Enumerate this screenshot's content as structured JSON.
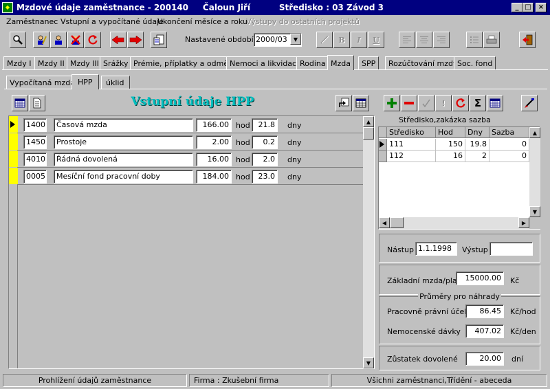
{
  "window": {
    "title": "Mzdové údaje zaměstnance - 200140     Čaloun Jiří          Středisko : 03 Závod 3",
    "icon": "app-icon"
  },
  "menu": {
    "employee": "Zaměstnanec",
    "inputs": "Vstupní a vypočítané údaje",
    "closing": "Ukončení měsíce a roku",
    "outputs": "Výstupy do ostatních projektů"
  },
  "toolbar": {
    "period_label": "Nastavené období",
    "period_value": "2000/03",
    "bold": "B",
    "italic": "I",
    "underline": "U"
  },
  "tabs": [
    {
      "label": "Mzdy I"
    },
    {
      "label": "Mzdy II"
    },
    {
      "label": "Mzdy III"
    },
    {
      "label": "Srážky"
    },
    {
      "label": "Prémie, příplatky a odměny"
    },
    {
      "label": "Nemoci a likvidace"
    },
    {
      "label": "Rodina"
    },
    {
      "label": "Mzda"
    },
    {
      "label": "SPP"
    },
    {
      "label": "Rozúčtování mzdy"
    },
    {
      "label": "Soc. fond"
    }
  ],
  "subtabs": [
    {
      "label": "Vypočítaná mzda"
    },
    {
      "label": "HPP"
    },
    {
      "label": "úklid"
    }
  ],
  "main": {
    "heading": "Vstupní údaje HPP",
    "rows": [
      {
        "code": "1400",
        "name": "Časová mzda",
        "hours": "166.00",
        "hours_unit": "hod",
        "days": "21.8",
        "days_unit": "dny"
      },
      {
        "code": "1450",
        "name": "Prostoje",
        "hours": "2.00",
        "hours_unit": "hod",
        "days": "0.2",
        "days_unit": "dny"
      },
      {
        "code": "4010",
        "name": "Řádná dovolená",
        "hours": "16.00",
        "hours_unit": "hod",
        "days": "2.0",
        "days_unit": "dny"
      },
      {
        "code": "0005",
        "name": "Mesíční fond pracovní doby",
        "hours": "184.00",
        "hours_unit": "hod",
        "days": "23.0",
        "days_unit": "dny"
      }
    ]
  },
  "cost_grid": {
    "title": "Středisko,zakázka sazba",
    "columns": [
      "Středisko",
      "Hod",
      "Dny",
      "Sazba"
    ],
    "rows": [
      [
        "111",
        "150",
        "19.8",
        "0"
      ],
      [
        "112",
        "16",
        "2",
        "0"
      ]
    ],
    "sigma": "Σ"
  },
  "employment": {
    "start_label": "Nástup",
    "start_value": "1.1.1998",
    "end_label": "Výstup",
    "end_value": "",
    "salary_label": "Základní mzda/plat",
    "salary_value": "15000.00",
    "salary_unit": "Kč",
    "averages_title": "Průměry pro náhrady",
    "labor_label": "Pracovně právní účely",
    "labor_value": "86.45",
    "labor_unit": "Kč/hod",
    "sick_label": "Nemocenské dávky",
    "sick_value": "407.02",
    "sick_unit": "Kč/den",
    "vacation_label": "Zůstatek dovolené",
    "vacation_value": "20.00",
    "vacation_unit": "dní"
  },
  "status": {
    "mode": "Prohlížení údajů zaměstnance",
    "company": "Firma :  Zkušební firma",
    "filter": "Všichni zaměstnanci,Třídění - abeceda"
  }
}
